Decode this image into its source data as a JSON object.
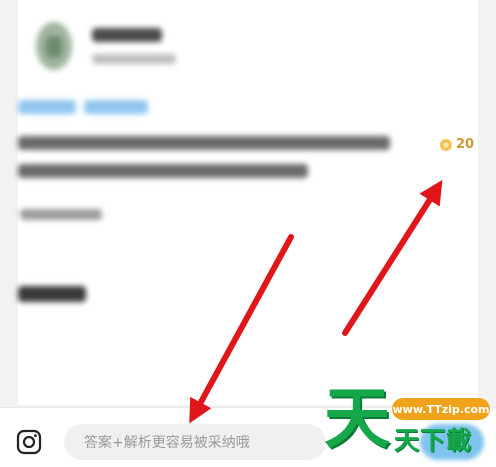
{
  "question": {
    "reward_value": "20",
    "icons": {
      "reward": "coin-icon"
    }
  },
  "bottom_bar": {
    "answer_input_placeholder": "答案+解析更容易被采纳哦",
    "answer_input_value": "",
    "icons": {
      "camera": "camera-icon"
    }
  },
  "watermark": {
    "big_char": "天",
    "url": "www.TTzip.com",
    "chars": "天下載"
  },
  "colors": {
    "accent_blue": "#7fc3ef",
    "reward_gold": "#c99a2e",
    "arrow_red": "#e0161b",
    "watermark_green": "#14a84a",
    "watermark_orange": "#f0a21b"
  }
}
